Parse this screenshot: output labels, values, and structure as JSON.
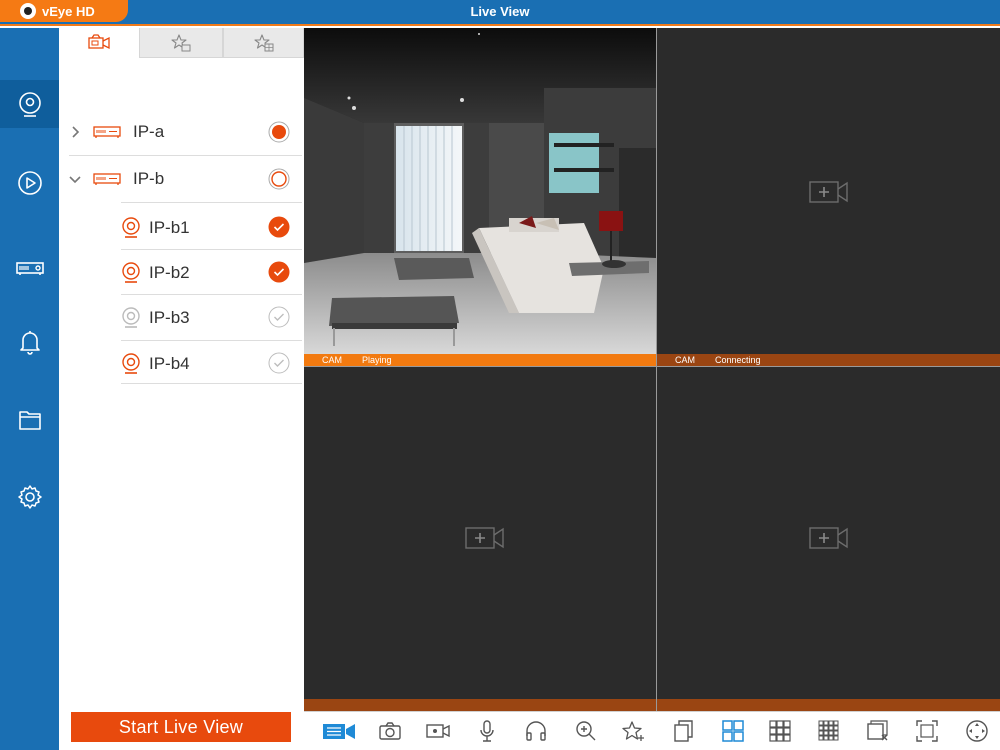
{
  "app": {
    "name": "vEye HD",
    "window_title": "Live View"
  },
  "theme": {
    "primary": "#1a6fb3",
    "accent": "#e84a0d",
    "status_playing": "#f27a10",
    "status_other": "#9a4512"
  },
  "sidebar": {
    "items": [
      {
        "icon": "live-view-icon",
        "active": true
      },
      {
        "icon": "playback-icon",
        "active": false
      },
      {
        "icon": "device-manager-icon",
        "active": false
      },
      {
        "icon": "alarm-bell-icon",
        "active": false
      },
      {
        "icon": "folder-icon",
        "active": false
      },
      {
        "icon": "settings-gear-icon",
        "active": false
      }
    ]
  },
  "panel": {
    "tabs": [
      {
        "icon": "device-list-icon",
        "active": true
      },
      {
        "icon": "favorites-group-icon",
        "active": false
      },
      {
        "icon": "favorites-grid-icon",
        "active": false
      }
    ],
    "devices": [
      {
        "label": "IP-a",
        "type": "recorder",
        "expanded": false,
        "state": "selected-dot"
      },
      {
        "label": "IP-b",
        "type": "recorder",
        "expanded": true,
        "state": "empty"
      },
      {
        "label": "IP-b1",
        "type": "camera",
        "state": "checked"
      },
      {
        "label": "IP-b2",
        "type": "camera",
        "state": "checked"
      },
      {
        "label": "IP-b3",
        "type": "camera-offline",
        "state": "unchecked"
      },
      {
        "label": "IP-b4",
        "type": "camera",
        "state": "unchecked"
      }
    ],
    "start_button": "Start Live View"
  },
  "video_cells": [
    {
      "status_name": "CAM",
      "status_text": "Playing",
      "has_feed": true
    },
    {
      "status_name": "CAM",
      "status_text": "Connecting",
      "has_feed": false
    },
    {
      "status_name": "",
      "status_text": "",
      "has_feed": false
    },
    {
      "status_name": "",
      "status_text": "",
      "has_feed": false
    }
  ],
  "toolbar": {
    "tools": [
      "stream-select-icon",
      "snapshot-icon",
      "record-icon",
      "microphone-icon",
      "audio-headphones-icon",
      "zoom-in-icon",
      "favorite-star-icon",
      "copy-pages-icon",
      "layout-4-icon",
      "layout-9-icon",
      "layout-16-icon",
      "close-all-icon",
      "fullscreen-icon",
      "ptz-control-icon"
    ]
  }
}
